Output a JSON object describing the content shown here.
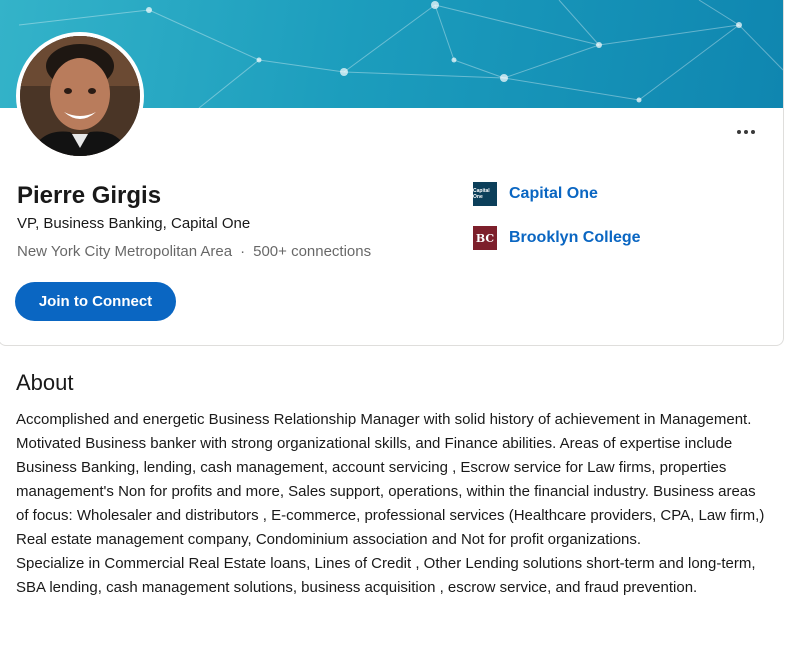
{
  "profile": {
    "name": "Pierre Girgis",
    "headline": "VP, Business Banking, Capital One",
    "location": "New York City Metropolitan Area",
    "separator": "·",
    "connections": "500+ connections",
    "join_button": "Join to Connect",
    "more_icon": "ellipsis-icon"
  },
  "organizations": [
    {
      "name": "Capital One",
      "logo_text": "Capital One",
      "logo_color": "#0c3f5a"
    },
    {
      "name": "Brooklyn College",
      "logo_text": "BC",
      "logo_color": "#7d1f2b"
    }
  ],
  "about": {
    "title": "About",
    "text": "Accomplished and energetic Business Relationship Manager with solid history of achievement in Management. Motivated Business banker with strong organizational skills, and Finance abilities. Areas of expertise include Business Banking, lending, cash management, account servicing , Escrow service for Law firms, properties management's Non for profits and more, Sales support, operations, within the financial industry. Business areas of focus: Wholesaler and distributors , E-commerce, professional services (Healthcare providers, CPA, Law firm,) Real estate management company, Condominium association and Not for profit organizations.\nSpecialize in Commercial Real Estate loans, Lines of Credit , Other Lending solutions short-term and long-term, SBA lending, cash management solutions, business acquisition , escrow service, and fraud prevention."
  },
  "colors": {
    "accent": "#0a66c2",
    "cover_start": "#34b3c9",
    "cover_end": "#0f86b0"
  }
}
